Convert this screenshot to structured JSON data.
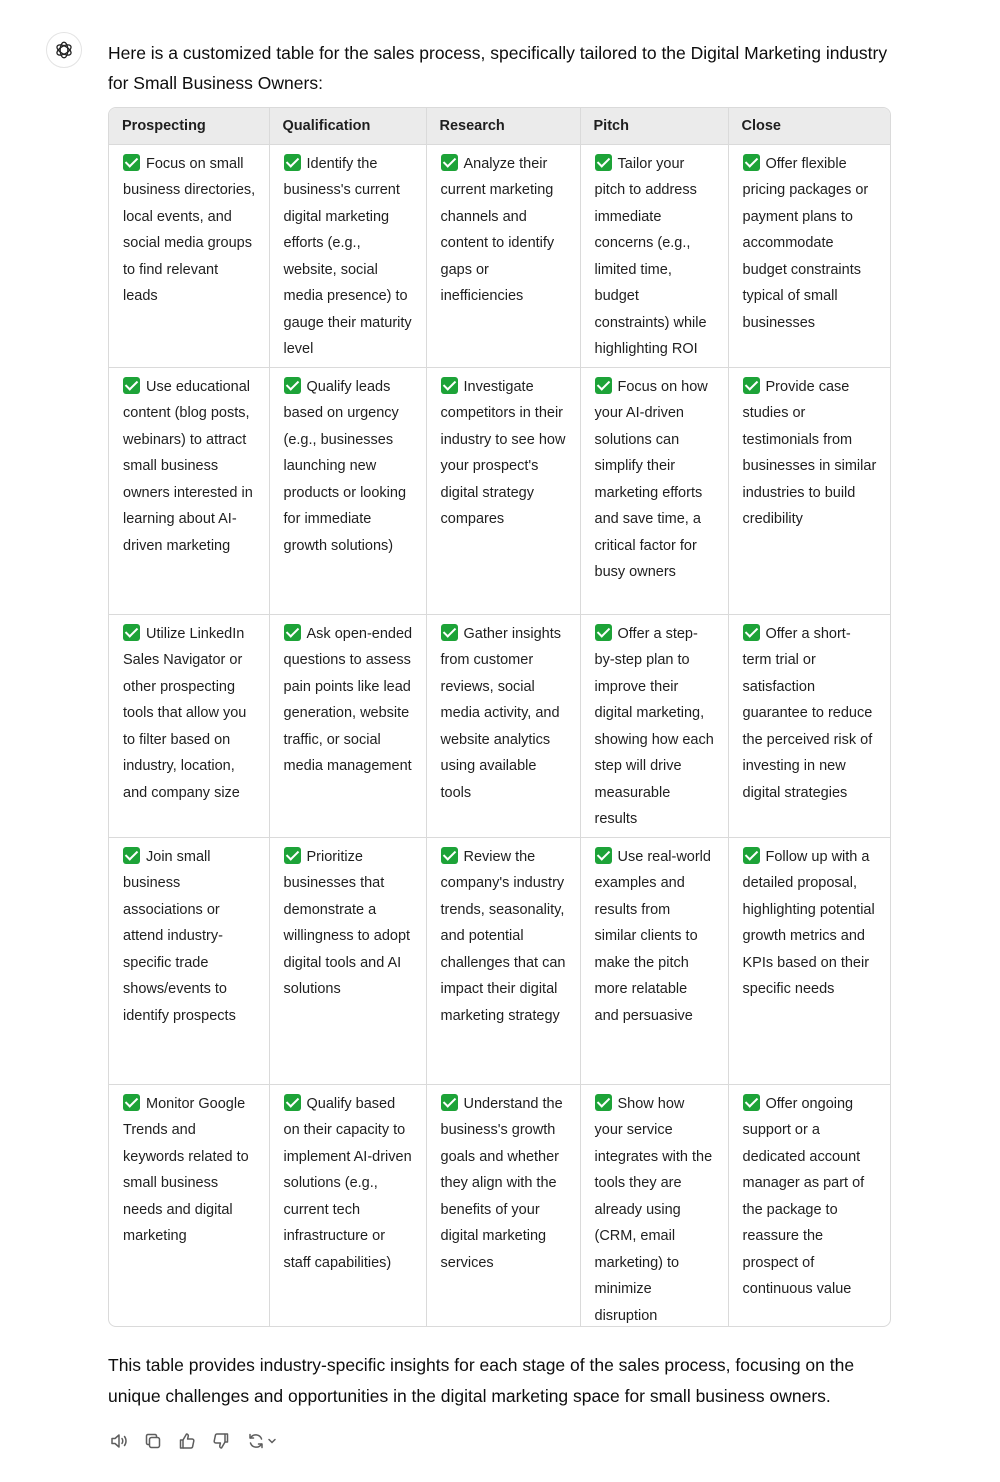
{
  "message": {
    "intro": "Here is a customized table for the sales process, specifically tailored to the Digital Marketing industry for Small Business Owners:",
    "outro": "This table provides industry-specific insights for each stage of the sales process, focusing on the unique challenges and opportunities in the digital marketing space for small business owners."
  },
  "table": {
    "headers": [
      "Prospecting",
      "Qualification",
      "Research",
      "Pitch",
      "Close"
    ],
    "rows": [
      [
        "Focus on small business directories, local events, and social media groups to find relevant leads",
        "Identify the business's current digital marketing efforts (e.g., website, social media presence) to gauge their maturity level",
        "Analyze their current marketing channels and content to identify gaps or inefficiencies",
        "Tailor your pitch to address immediate concerns (e.g., limited time, budget constraints) while highlighting ROI",
        "Offer flexible pricing packages or payment plans to accommodate budget constraints typical of small businesses"
      ],
      [
        "Use educational content (blog posts, webinars) to attract small business owners interested in learning about AI-driven marketing",
        "Qualify leads based on urgency (e.g., businesses launching new products or looking for immediate growth solutions)",
        "Investigate competitors in their industry to see how your prospect's digital strategy compares",
        "Focus on how your AI-driven solutions can simplify their marketing efforts and save time, a critical factor for busy owners",
        "Provide case studies or testimonials from businesses in similar industries to build credibility"
      ],
      [
        "Utilize LinkedIn Sales Navigator or other prospecting tools that allow you to filter based on industry, location, and company size",
        "Ask open-ended questions to assess pain points like lead generation, website traffic, or social media management",
        "Gather insights from customer reviews, social media activity, and website analytics using available tools",
        "Offer a step-by-step plan to improve their digital marketing, showing how each step will drive measurable results",
        "Offer a short-term trial or satisfaction guarantee to reduce the perceived risk of investing in new digital strategies"
      ],
      [
        "Join small business associations or attend industry-specific trade shows/events to identify prospects",
        "Prioritize businesses that demonstrate a willingness to adopt digital tools and AI solutions",
        "Review the company's industry trends, seasonality, and potential challenges that can impact their digital marketing strategy",
        "Use real-world examples and results from similar clients to make the pitch more relatable and persuasive",
        "Follow up with a detailed proposal, highlighting potential growth metrics and KPIs based on their specific needs"
      ],
      [
        "Monitor Google Trends and keywords related to small business needs and digital marketing",
        "Qualify based on their capacity to implement AI-driven solutions (e.g., current tech infrastructure or staff capabilities)",
        "Understand the business's growth goals and whether they align with the benefits of your digital marketing services",
        "Show how your service integrates with the tools they are already using (CRM, email marketing) to minimize disruption",
        "Offer ongoing support or a dedicated account manager as part of the package to reassure the prospect of continuous value"
      ]
    ]
  },
  "icons": {
    "avatar": "openai-logo-icon",
    "check": "green-checkmark-icon",
    "actions": [
      "speaker-icon",
      "copy-icon",
      "thumbs-up-icon",
      "thumbs-down-icon",
      "regenerate-icon"
    ]
  },
  "colors": {
    "check_green": "#1da338",
    "header_bg": "#ebebeb",
    "border": "#dadada"
  }
}
